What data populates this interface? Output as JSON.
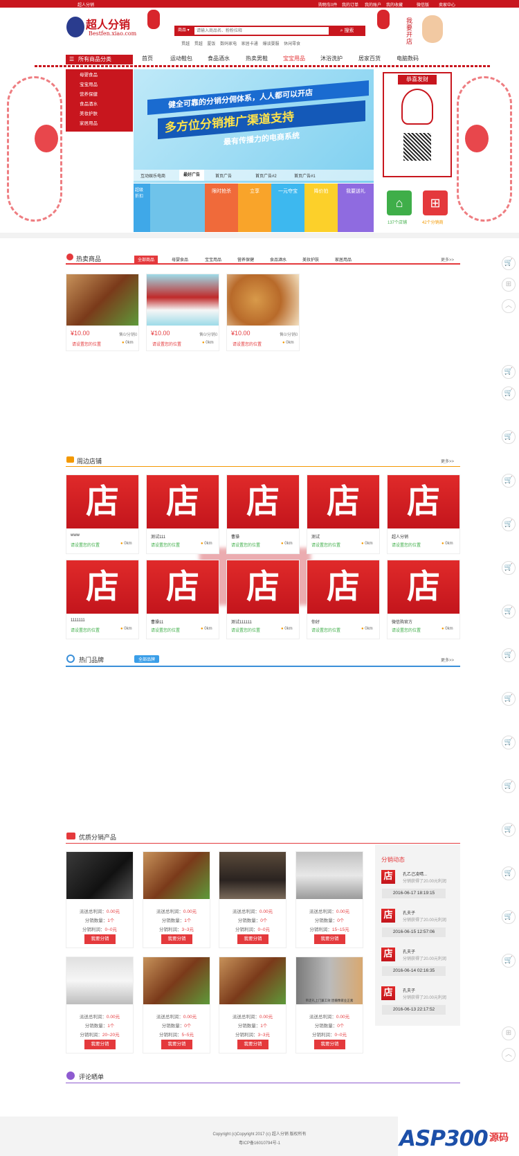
{
  "topbar": {
    "site": "超人分销",
    "cart": "购物车0件",
    "orders": "我的订单",
    "account": "我的账户",
    "favorites": "我的收藏",
    "wechat": "微信版",
    "seller": "卖家中心"
  },
  "logo": {
    "name": "超人分销",
    "url_text": "Bestfen.xiao.com"
  },
  "search": {
    "category": "商品",
    "placeholder": "请输入商品名、粉粉拉释",
    "button": "搜索",
    "hotwords": [
      "贯越",
      "贯越",
      "厦饭",
      "数码家电",
      "家居卡通",
      "爆谈婴服",
      "休闲零食"
    ]
  },
  "banner_right_text": "我要开店",
  "nav": {
    "all_categories": "所有商品分类",
    "items": [
      "首页",
      "运动鞋包",
      "食品酒水",
      "热卖男鞋",
      "宝宝用品",
      "沐浴洗护",
      "居家百货",
      "电脑数码"
    ],
    "active_index": 4,
    "categories": [
      "母婴食品",
      "宝宝用品",
      "营养保健",
      "食品酒水",
      "美妆护肤",
      "家居用品"
    ]
  },
  "hero": {
    "line1": "健全可靠的分销分佣体系，人人都可以开店",
    "line2": "多方位分销推广渠道支持",
    "line3": "最有传播力的电商系统",
    "tabs": [
      "互动娱乐电商",
      "最好广告",
      "首页广告",
      "首页广告#2",
      "首页广告#1"
    ],
    "active_tab": 1
  },
  "promo_tiles": [
    "超级\n折扣",
    "",
    "限时抢杀",
    "立享",
    "一元夺宝",
    "降价拍",
    "我要送礼"
  ],
  "greeting": {
    "title": "恭喜发财"
  },
  "stats": {
    "shops": "137个店铺",
    "distributors": "42个分销商"
  },
  "hot": {
    "title": "热卖商品",
    "tabs": [
      "全部商品",
      "母婴食品",
      "宝宝用品",
      "营养保健",
      "食品酒水",
      "美妆护肤",
      "家居用品"
    ],
    "more": "更多>>",
    "products": [
      {
        "price": "¥10.00",
        "sales": "售0/分销0",
        "loc": "请设置您的位置",
        "dist": "0km"
      },
      {
        "price": "¥10.00",
        "sales": "售0/分销0",
        "loc": "请设置您的位置",
        "dist": "0km"
      },
      {
        "price": "¥10.00",
        "sales": "售0/分销0",
        "loc": "请设置您的位置",
        "dist": "0km"
      }
    ]
  },
  "shops": {
    "title": "周边店铺",
    "more": "更多>>",
    "glyph": "店",
    "items": [
      {
        "name": "www",
        "loc": "请设置您的位置",
        "dist": "0km"
      },
      {
        "name": "测试111",
        "loc": "请设置您的位置",
        "dist": "0km"
      },
      {
        "name": "曹操",
        "loc": "请设置您的位置",
        "dist": "0km"
      },
      {
        "name": "测试",
        "loc": "请设置您的位置",
        "dist": "0km"
      },
      {
        "name": "超人分销",
        "loc": "请设置您的位置",
        "dist": "0km"
      },
      {
        "name": "1111111",
        "loc": "请设置您的位置",
        "dist": "0km"
      },
      {
        "name": "曹操11",
        "loc": "请设置您的位置",
        "dist": "0km"
      },
      {
        "name": "测试111111",
        "loc": "请设置您的位置",
        "dist": "0km"
      },
      {
        "name": "你好",
        "loc": "请设置您的位置",
        "dist": "0km"
      },
      {
        "name": "微信购官方",
        "loc": "请设置您的位置",
        "dist": "0km"
      }
    ]
  },
  "brands": {
    "title": "热门品牌",
    "tab": "全部品牌",
    "more": "更多>>"
  },
  "dist": {
    "title": "优质分销产品",
    "btn": "我要分销",
    "label_profit": "派送总利润：",
    "label_count": "分销数量：",
    "label_range": "分销利润：",
    "items": [
      {
        "profit": "0.00元",
        "count": "1个",
        "range": "0~0元"
      },
      {
        "profit": "0.00元",
        "count": "1个",
        "range": "3~3元"
      },
      {
        "profit": "0.00元",
        "count": "0个",
        "range": "0~0元"
      },
      {
        "profit": "0.00元",
        "count": "0个",
        "range": "15~15元"
      },
      {
        "profit": "0.00元",
        "count": "1个",
        "range": "20~20元"
      },
      {
        "profit": "0.00元",
        "count": "0个",
        "range": "5~5元"
      },
      {
        "profit": "0.00元",
        "count": "1个",
        "range": "3~3元"
      },
      {
        "profit": "0.00元",
        "count": "0个",
        "range": "0~0元"
      }
    ],
    "img8_caption": "带走礼上门兼工效  因摄像家业正素"
  },
  "feed": {
    "title": "分销动态",
    "items": [
      {
        "name": "孔乙己凌晴...",
        "desc": "分销获得了20.00元利润",
        "time": "2016-06-17 18:19:15"
      },
      {
        "name": "孔夫子",
        "desc": "分销获得了20.00元利润",
        "time": "2016-06-15 12:57:06"
      },
      {
        "name": "孔夫子",
        "desc": "分销获得了20.00元利润",
        "time": "2016-06-14 02:16:35"
      },
      {
        "name": "孔夫子",
        "desc": "分销获得了20.00元利润",
        "time": "2016-06-13 22:17:52"
      }
    ]
  },
  "reviews": {
    "title": "评论晒单"
  },
  "footer": {
    "copyright": "Copyright (c)Copyright 2017 (c) 超人分销 版权所有",
    "icp": "粤ICP备16010794号-1",
    "watermark": "ASP300",
    "watermark_suffix": "源码"
  }
}
